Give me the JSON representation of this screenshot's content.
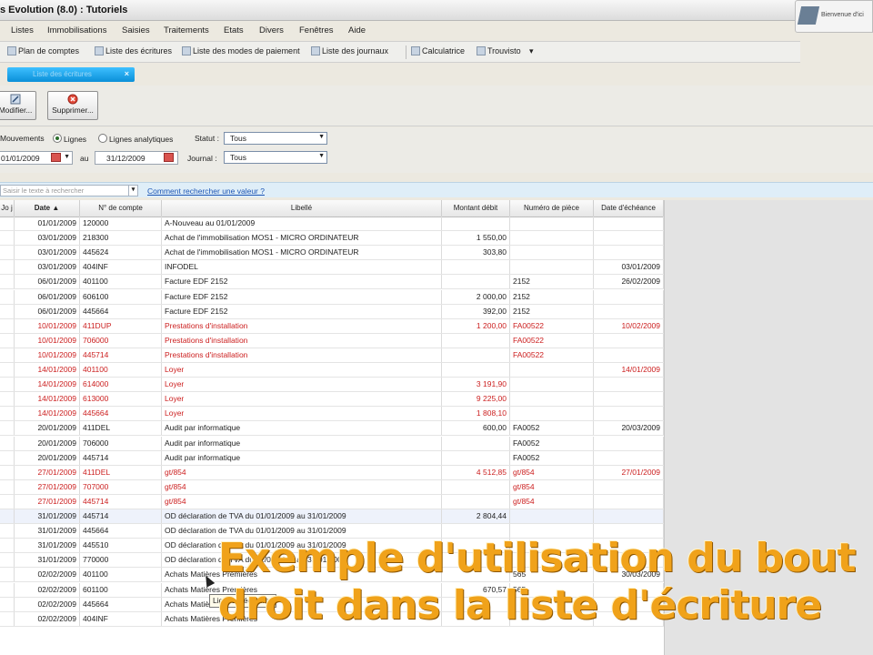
{
  "window": {
    "title": "s Evolution (8.0) : Tutoriels",
    "badge_text": "Bienvenue d'ici"
  },
  "menu": [
    "Listes",
    "Immobilisations",
    "Saisies",
    "Traitements",
    "Etats",
    "Divers",
    "Fenêtres",
    "Aide"
  ],
  "toolbar": [
    "Plan de comptes",
    "Liste des écritures",
    "Liste des modes de paiement",
    "Liste des journaux",
    "Calculatrice",
    "Trouvisto"
  ],
  "tab": {
    "label": "Liste des écritures"
  },
  "actions": {
    "modify": "Modifier...",
    "delete": "Supprimer..."
  },
  "filters": {
    "mode_prefix": "Mouvements",
    "radio_lines": "Lignes",
    "radio_analytic": "Lignes analytiques",
    "status_label": "Statut :",
    "status_value": "Tous",
    "date_from": "01/01/2009",
    "date_to_label": "au",
    "date_to": "31/12/2009",
    "journal_label": "Journal :",
    "journal_value": "Tous"
  },
  "search": {
    "placeholder": "Saisir le texte à rechercher",
    "help_link": "Comment rechercher une valeur ?"
  },
  "grid": {
    "columns": [
      "Jo j",
      "Date",
      "N° de compte",
      "Libellé",
      "Montant débit",
      "Numéro de pièce",
      "Date d'échéance"
    ],
    "rows": [
      {
        "date": "01/01/2009",
        "account": "120000",
        "label": "A-Nouveau au 01/01/2009",
        "debit": "",
        "piece": "",
        "due": "",
        "red": false
      },
      {
        "date": "03/01/2009",
        "account": "218300",
        "label": "Achat de l'immobilisation MOS1 - MICRO ORDINATEUR",
        "debit": "1 550,00",
        "piece": "",
        "due": "",
        "red": false
      },
      {
        "date": "03/01/2009",
        "account": "445624",
        "label": "Achat de l'immobilisation MOS1 - MICRO ORDINATEUR",
        "debit": "303,80",
        "piece": "",
        "due": "",
        "red": false
      },
      {
        "date": "03/01/2009",
        "account": "404INF",
        "label": "INFODEL",
        "debit": "",
        "piece": "",
        "due": "03/01/2009",
        "red": false
      },
      {
        "date": "06/01/2009",
        "account": "401100",
        "label": "Facture EDF 2152",
        "debit": "",
        "piece": "2152",
        "due": "26/02/2009",
        "red": false
      },
      {
        "date": "06/01/2009",
        "account": "606100",
        "label": "Facture EDF 2152",
        "debit": "2 000,00",
        "piece": "2152",
        "due": "",
        "red": false
      },
      {
        "date": "06/01/2009",
        "account": "445664",
        "label": "Facture EDF 2152",
        "debit": "392,00",
        "piece": "2152",
        "due": "",
        "red": false
      },
      {
        "date": "10/01/2009",
        "account": "411DUP",
        "label": "Prestations d'installation",
        "debit": "1 200,00",
        "piece": "FA00522",
        "due": "10/02/2009",
        "red": true
      },
      {
        "date": "10/01/2009",
        "account": "706000",
        "label": "Prestations d'installation",
        "debit": "",
        "piece": "FA00522",
        "due": "",
        "red": true
      },
      {
        "date": "10/01/2009",
        "account": "445714",
        "label": "Prestations d'installation",
        "debit": "",
        "piece": "FA00522",
        "due": "",
        "red": true
      },
      {
        "date": "14/01/2009",
        "account": "401100",
        "label": "Loyer",
        "debit": "",
        "piece": "",
        "due": "14/01/2009",
        "red": true
      },
      {
        "date": "14/01/2009",
        "account": "614000",
        "label": "Loyer",
        "debit": "3 191,90",
        "piece": "",
        "due": "",
        "red": true
      },
      {
        "date": "14/01/2009",
        "account": "613000",
        "label": "Loyer",
        "debit": "9 225,00",
        "piece": "",
        "due": "",
        "red": true
      },
      {
        "date": "14/01/2009",
        "account": "445664",
        "label": "Loyer",
        "debit": "1 808,10",
        "piece": "",
        "due": "",
        "red": true
      },
      {
        "date": "20/01/2009",
        "account": "411DEL",
        "label": "Audit par informatique",
        "debit": "600,00",
        "piece": "FA0052",
        "due": "20/03/2009",
        "red": false
      },
      {
        "date": "20/01/2009",
        "account": "706000",
        "label": "Audit par informatique",
        "debit": "",
        "piece": "FA0052",
        "due": "",
        "red": false
      },
      {
        "date": "20/01/2009",
        "account": "445714",
        "label": "Audit par informatique",
        "debit": "",
        "piece": "FA0052",
        "due": "",
        "red": false
      },
      {
        "date": "27/01/2009",
        "account": "411DEL",
        "label": "gt/854",
        "debit": "4 512,85",
        "piece": "gt/854",
        "due": "27/01/2009",
        "red": true
      },
      {
        "date": "27/01/2009",
        "account": "707000",
        "label": "gt/854",
        "debit": "",
        "piece": "gt/854",
        "due": "",
        "red": true
      },
      {
        "date": "27/01/2009",
        "account": "445714",
        "label": "gt/854",
        "debit": "",
        "piece": "gt/854",
        "due": "",
        "red": true
      },
      {
        "date": "31/01/2009",
        "account": "445714",
        "label": "OD déclaration de TVA du 01/01/2009 au 31/01/2009",
        "debit": "2 804,44",
        "piece": "",
        "due": "",
        "red": false
      },
      {
        "date": "31/01/2009",
        "account": "445664",
        "label": "OD déclaration de TVA du 01/01/2009 au 31/01/2009",
        "debit": "",
        "piece": "",
        "due": "",
        "red": false
      },
      {
        "date": "31/01/2009",
        "account": "445510",
        "label": "OD déclaration de TVA du 01/01/2009 au 31/01/2009",
        "debit": "",
        "piece": "",
        "due": "",
        "red": false
      },
      {
        "date": "31/01/2009",
        "account": "770000",
        "label": "OD déclaration de TVA du 01/01/2009 au 31/01/2009",
        "debit": "",
        "piece": "",
        "due": "",
        "red": false
      },
      {
        "date": "02/02/2009",
        "account": "401100",
        "label": "Achats Matières Premières",
        "debit": "",
        "piece": "565",
        "due": "30/03/2009",
        "red": false
      },
      {
        "date": "02/02/2009",
        "account": "601100",
        "label": "Achats Matières Premières",
        "debit": "670,57",
        "piece": "565",
        "due": "",
        "red": false
      },
      {
        "date": "02/02/2009",
        "account": "445664",
        "label": "Achats Matières Premières",
        "debit": "",
        "piece": "",
        "due": "",
        "red": false
      },
      {
        "date": "02/02/2009",
        "account": "404INF",
        "label": "Achats Matières Premières",
        "debit": "",
        "piece": "",
        "due": "",
        "red": false
      }
    ]
  },
  "tooltip": "Lignes d'écritures",
  "overlay": {
    "line1": "Exemple d'utilisation du bout",
    "line2": "droit dans la liste d'écriture"
  },
  "colors": {
    "accent_tab": "#0a8fd8",
    "red_row": "#cc2020",
    "overlay_text": "#f0a21a"
  }
}
